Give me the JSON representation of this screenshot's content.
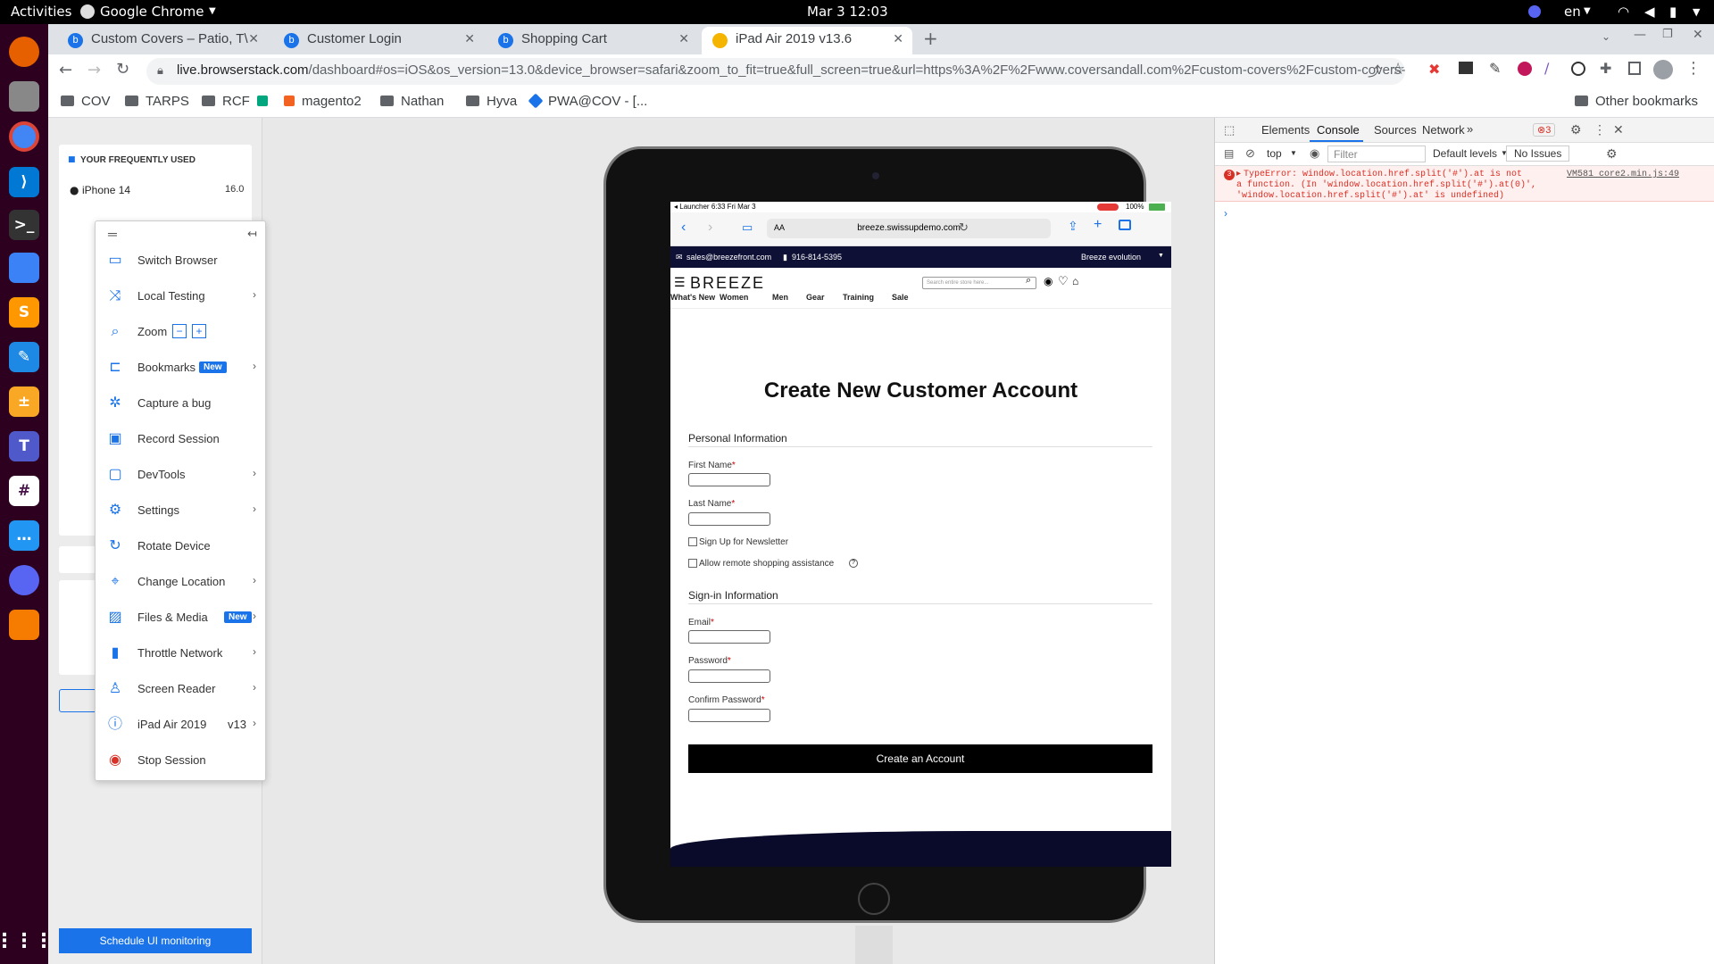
{
  "system": {
    "activities": "Activities",
    "app": "Google Chrome",
    "datetime": "Mar 3  12:03",
    "lang": "en"
  },
  "tabs": [
    {
      "title": "Custom Covers – Patio, T\\"
    },
    {
      "title": "Customer Login"
    },
    {
      "title": "Shopping Cart"
    },
    {
      "title": "iPad Air 2019 v13.6"
    }
  ],
  "url": {
    "host": "live.browserstack.com",
    "path": "/dashboard#os=iOS&os_version=13.0&device_browser=safari&zoom_to_fit=true&full_screen=true&url=https%3A%2F%2Fwww.coversandall.com%2Fcustom-covers%2Fcustom-covers-p&..."
  },
  "bookmarks": [
    "COV",
    "TARPS",
    "RCF",
    "magento2",
    "Nathan",
    "Hyva",
    "PWA@COV - [..."
  ],
  "bookmarks_other": "Other bookmarks",
  "left_panel": {
    "heading": "YOUR FREQUENTLY USED",
    "first_device": "iPhone 14",
    "first_version": "16.0",
    "schedule_btn": "Schedule UI monitoring"
  },
  "menu": {
    "items": [
      {
        "label": "Switch Browser",
        "icon": "monitor-icon"
      },
      {
        "label": "Local Testing",
        "icon": "shuffle-icon"
      },
      {
        "label": "Zoom",
        "icon": "zoom-icon"
      },
      {
        "label": "Bookmarks",
        "icon": "bookmark-icon",
        "badge": "New"
      },
      {
        "label": "Capture a bug",
        "icon": "bug-icon"
      },
      {
        "label": "Record Session",
        "icon": "video-icon"
      },
      {
        "label": "DevTools",
        "icon": "devtools-icon"
      },
      {
        "label": "Settings",
        "icon": "gear-icon"
      },
      {
        "label": "Rotate Device",
        "icon": "rotate-icon"
      },
      {
        "label": "Change Location",
        "icon": "location-icon"
      },
      {
        "label": "Files & Media",
        "icon": "image-icon",
        "badge": "New"
      },
      {
        "label": "Throttle Network",
        "icon": "signal-icon"
      },
      {
        "label": "Screen Reader",
        "icon": "accessibility-icon"
      },
      {
        "label": "iPad Air 2019",
        "icon": "info-icon",
        "extra": "v13"
      },
      {
        "label": "Stop Session",
        "icon": "stop-icon"
      }
    ]
  },
  "ipad": {
    "status_left": "◂ Launcher   6:33   Fri Mar 3",
    "status_right": "100%",
    "safari_aa": "AA",
    "safari_url": "breeze.swissupdemo.com",
    "topbar_email": "sales@breezefront.com",
    "topbar_phone": "916-814-5395",
    "topbar_right": "Breeze evolution",
    "logo": "BREEZE",
    "search_placeholder": "Search entire store here...",
    "nav": [
      "What's New",
      "Women",
      "Men",
      "Gear",
      "Training",
      "Sale"
    ],
    "page_title": "Create New Customer Account",
    "personal_info": "Personal Information",
    "first_name": "First Name",
    "last_name": "Last Name",
    "newsletter": "Sign Up for Newsletter",
    "remote_assist": "Allow remote shopping assistance",
    "signin_info": "Sign-in Information",
    "email": "Email",
    "password": "Password",
    "confirm_password": "Confirm Password",
    "create_btn": "Create an Account"
  },
  "devtools": {
    "tabs": [
      "Elements",
      "Console",
      "Sources",
      "Network"
    ],
    "error_count": "3",
    "context": "top",
    "filter_placeholder": "Filter",
    "levels": "Default levels",
    "issues": "No Issues",
    "error_badge": "3",
    "error_line1": "TypeError: window.location.href.split('#').at is not",
    "error_line2": "a function. (In 'window.location.href.split('#').at(0)',",
    "error_line3": "'window.location.href.split('#').at' is undefined)",
    "error_source": "VM581 core2.min.js:49"
  }
}
